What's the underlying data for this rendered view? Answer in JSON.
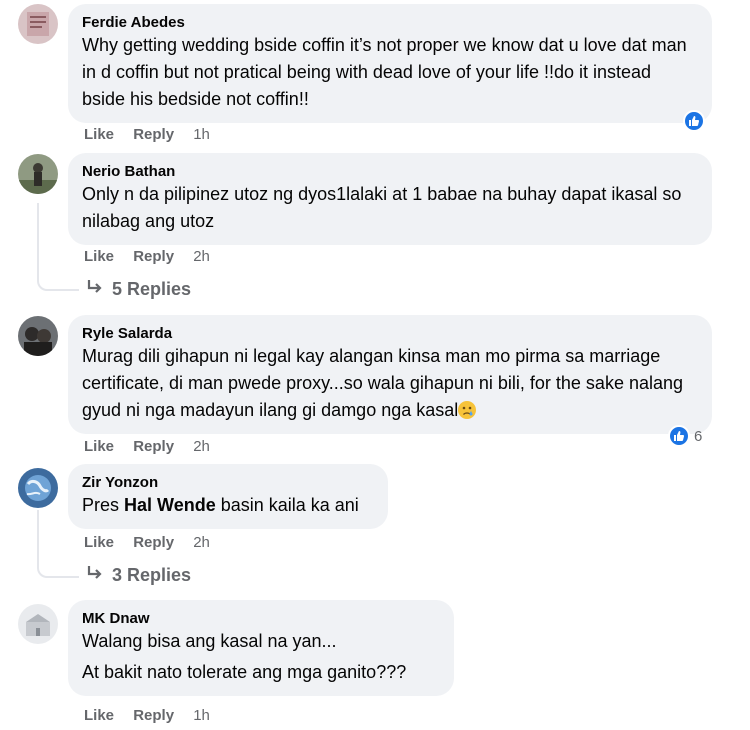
{
  "comments": [
    {
      "author": "Ferdie Abedes",
      "lines": [
        "Why getting wedding bside coffin it’s not proper we know dat u love dat man in d coffin but not pratical being with dead love of your life !!do it instead bside his bedside not coffin!!"
      ],
      "like": "Like",
      "reply": "Reply",
      "time": "1h",
      "reaction": "like"
    },
    {
      "author": "Nerio Bathan",
      "lines": [
        "Only n da pilipinez utoz ng dyos1lalaki at 1 babae na buhay dapat ikasal so nilabag ang utoz"
      ],
      "like": "Like",
      "reply": "Reply",
      "time": "2h",
      "replies": "5 Replies"
    },
    {
      "author": "Ryle Salarda",
      "text": "Murag dili gihapun ni legal kay alangan kinsa man mo pirma sa marriage certificate, di man pwede proxy...so wala gihapun ni bili, for the sake nalang gyud ni nga madayun ilang gi damgo nga kasal",
      "emoji": "crying-face",
      "like": "Like",
      "reply": "Reply",
      "time": "2h",
      "reaction": "like",
      "reaction_count": "6"
    },
    {
      "author": "Zir Yonzon",
      "prefix": "Pres ",
      "mention": "Hal Wende",
      "suffix": " basin kaila ka ani",
      "like": "Like",
      "reply": "Reply",
      "time": "2h",
      "replies": "3 Replies"
    },
    {
      "author": "MK Dnaw",
      "lines": [
        "Walang bisa ang kasal na yan...",
        "At bakit nato tolerate ang mga ganito???"
      ],
      "like": "Like",
      "reply": "Reply",
      "time": "1h"
    }
  ],
  "icons": {
    "reaction": "thumbs-up-icon",
    "replies": "reply-arrow-icon"
  },
  "colors": {
    "bubble": "#f0f2f5",
    "meta": "#65676b",
    "like_blue": "#1b74e4",
    "text": "#050505"
  }
}
